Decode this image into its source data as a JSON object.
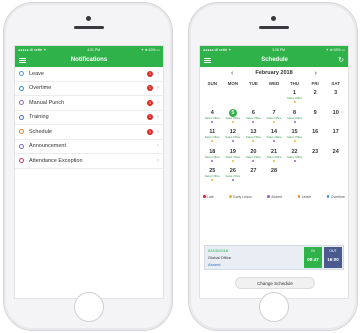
{
  "left_screen": {
    "status": {
      "carrier": "●●●●● dll settle ✦",
      "time": "4:21 PM",
      "battery": "✦ ⊕ 63% ▭"
    },
    "title": "Notifications",
    "items": [
      {
        "label": "Leave",
        "badge": "1",
        "color": "#4c9be8"
      },
      {
        "label": "Overtime",
        "badge": "1",
        "color": "#2f8fd8"
      },
      {
        "label": "Manual Punch",
        "badge": "1",
        "color": "#9e62c9"
      },
      {
        "label": "Training",
        "badge": "1",
        "color": "#4e68c9"
      },
      {
        "label": "Schedule",
        "badge": "1",
        "color": "#f0842a"
      },
      {
        "label": "Announcement",
        "badge": "",
        "color": "#6f6fd6"
      },
      {
        "label": "Attendance Exception",
        "badge": "",
        "color": "#e0347a"
      }
    ]
  },
  "right_screen": {
    "status": {
      "carrier": "●●●●● dll settle ✦",
      "time": "3:26 PM",
      "battery": "✦ ⊕ 63% ▭"
    },
    "title": "Schedule",
    "month": "February 2018",
    "days_of_week": [
      "SUN",
      "MON",
      "TUE",
      "WED",
      "THU",
      "FRI",
      "SAT"
    ],
    "weeks": [
      [
        {
          "d": ""
        },
        {
          "d": ""
        },
        {
          "d": ""
        },
        {
          "d": ""
        },
        {
          "d": "1",
          "tag": "Sales Office"
        },
        {
          "d": "2"
        },
        {
          "d": "3"
        }
      ],
      [
        {
          "d": "4",
          "tag": "Sales Office"
        },
        {
          "d": "5",
          "tag": "Sales Office",
          "today": true
        },
        {
          "d": "6",
          "tag": "Sales Office"
        },
        {
          "d": "7",
          "tag": "Sales Office"
        },
        {
          "d": "8",
          "tag": "Sales Office"
        },
        {
          "d": "9"
        },
        {
          "d": "10"
        }
      ],
      [
        {
          "d": "11",
          "tag": "Sales Office"
        },
        {
          "d": "12",
          "tag": "Sales Office"
        },
        {
          "d": "13",
          "tag": "Sales Office"
        },
        {
          "d": "14",
          "tag": "Sales Office"
        },
        {
          "d": "15",
          "tag": "Sales Office"
        },
        {
          "d": "16"
        },
        {
          "d": "17"
        }
      ],
      [
        {
          "d": "18",
          "tag": "Sales Office"
        },
        {
          "d": "19",
          "tag": "Sales Office"
        },
        {
          "d": "20",
          "tag": "Sales Office"
        },
        {
          "d": "21",
          "tag": "Sales Office"
        },
        {
          "d": "22",
          "tag": "Sales Office"
        },
        {
          "d": "23"
        },
        {
          "d": "24"
        }
      ],
      [
        {
          "d": "25",
          "tag": "Sales Office"
        },
        {
          "d": "26",
          "tag": "Sales Office"
        },
        {
          "d": "27"
        },
        {
          "d": "28"
        },
        {
          "d": ""
        },
        {
          "d": ""
        },
        {
          "d": ""
        }
      ]
    ],
    "legend": [
      {
        "label": "Late",
        "color": "#e0271f"
      },
      {
        "label": "Early Leave",
        "color": "#f0b62a"
      },
      {
        "label": "Absent",
        "color": "#9e62c9"
      },
      {
        "label": "Leave",
        "color": "#f0842a"
      },
      {
        "label": "Overtime",
        "color": "#2f8fd8"
      }
    ],
    "shift": {
      "date": "02/05/2018",
      "office": "Global Office",
      "status": "Absent",
      "in_label": "IN",
      "in_time": "08:47",
      "out_label": "OUT",
      "out_time": "16:00"
    },
    "change_button": "Change Schedule"
  }
}
